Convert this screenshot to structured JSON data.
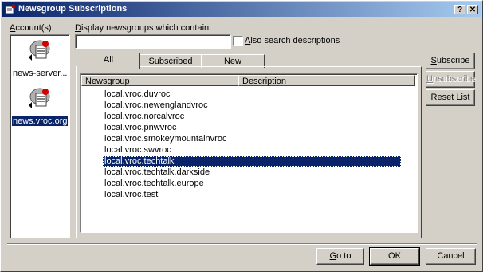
{
  "window": {
    "title": "Newsgroup Subscriptions",
    "help_btn": "?",
    "close_btn": "✕"
  },
  "accounts": {
    "label_prefix": "A",
    "label_rest": "ccount(s):",
    "items": [
      {
        "name": "news-server...",
        "selected": false
      },
      {
        "name": "news.vroc.org",
        "selected": true
      }
    ]
  },
  "filter": {
    "label_prefix": "D",
    "label_rest": "isplay newsgroups which contain:",
    "value": "",
    "also_search_prefix": "A",
    "also_search_rest": "lso search descriptions",
    "also_search_checked": false
  },
  "tabs": [
    {
      "label": "All",
      "active": true
    },
    {
      "label": "Subscribed",
      "active": false
    },
    {
      "label": "New",
      "active": false
    }
  ],
  "list": {
    "columns": [
      "Newsgroup",
      "Description"
    ],
    "rows": [
      "local.vroc.duvroc",
      "local.vroc.newenglandvroc",
      "local.vroc.norcalvroc",
      "local.vroc.pnwvroc",
      "local.vroc.smokeymountainvroc",
      "local.vroc.swvroc",
      "local.vroc.techtalk",
      "local.vroc.techtalk.darkside",
      "local.vroc.techtalk.europe",
      "local.vroc.test"
    ],
    "selected_row": "local.vroc.techtalk"
  },
  "side_buttons": {
    "subscribe_prefix": "S",
    "subscribe_rest": "ubscribe",
    "unsubscribe_prefix": "U",
    "unsubscribe_rest": "nsubscribe",
    "reset_prefix": "R",
    "reset_rest": "eset List"
  },
  "footer": {
    "goto_prefix": "G",
    "goto_rest": "o to",
    "ok": "OK",
    "cancel": "Cancel"
  },
  "colors": {
    "face": "#d4d0c8",
    "title_start": "#0a246a",
    "title_end": "#a6caf0",
    "selection": "#0a246a"
  }
}
